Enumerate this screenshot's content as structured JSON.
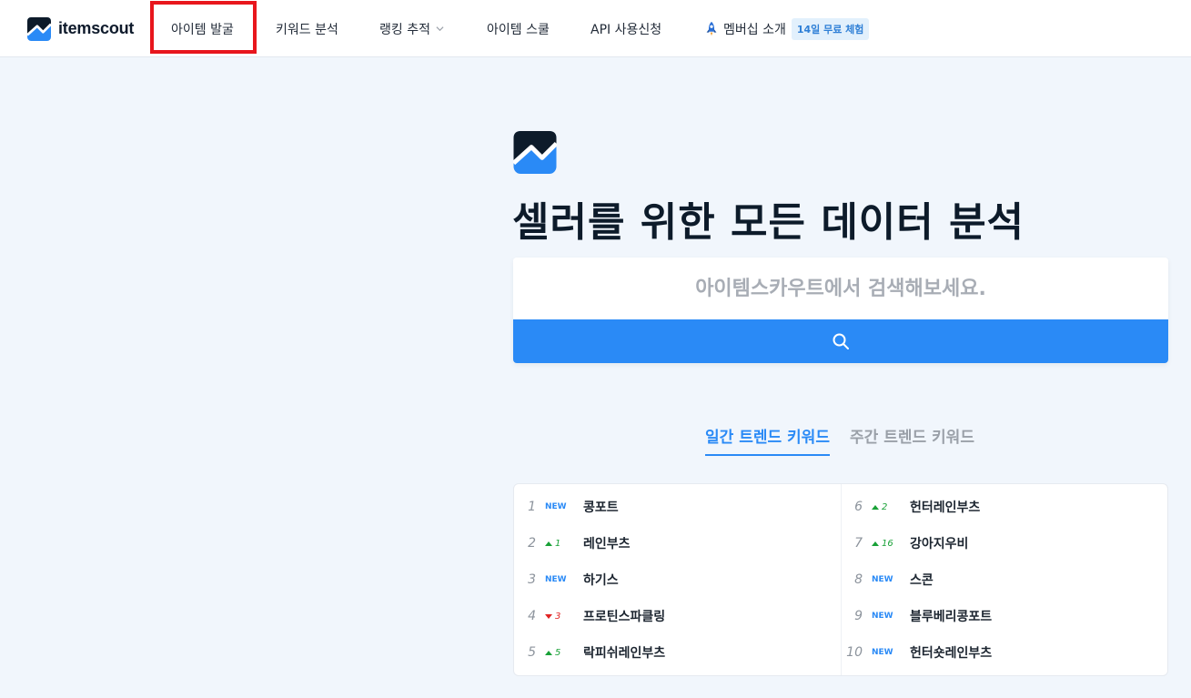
{
  "header": {
    "logo_text": "itemscout",
    "nav": [
      {
        "label": "아이템 발굴"
      },
      {
        "label": "키워드 분석"
      },
      {
        "label": "랭킹 추적"
      },
      {
        "label": "아이템 스쿨"
      },
      {
        "label": "API 사용신청"
      },
      {
        "label": "멤버십 소개"
      }
    ],
    "trial_badge": "14일 무료 체험"
  },
  "hero": {
    "title": "셀러를 위한 모든 데이터 분석",
    "search_placeholder": "아이템스카우트에서 검색해보세요."
  },
  "tabs": [
    {
      "label": "일간 트렌드 키워드",
      "active": true
    },
    {
      "label": "주간 트렌드 키워드",
      "active": false
    }
  ],
  "trends": [
    {
      "rank": "1",
      "change_type": "new",
      "change": "NEW",
      "keyword": "콩포트"
    },
    {
      "rank": "2",
      "change_type": "up",
      "change": "1",
      "keyword": "레인부츠"
    },
    {
      "rank": "3",
      "change_type": "new",
      "change": "NEW",
      "keyword": "하기스"
    },
    {
      "rank": "4",
      "change_type": "down",
      "change": "3",
      "keyword": "프로틴스파클링"
    },
    {
      "rank": "5",
      "change_type": "up",
      "change": "5",
      "keyword": "락피쉬레인부츠"
    },
    {
      "rank": "6",
      "change_type": "up",
      "change": "2",
      "keyword": "헌터레인부츠"
    },
    {
      "rank": "7",
      "change_type": "up",
      "change": "16",
      "keyword": "강아지우비"
    },
    {
      "rank": "8",
      "change_type": "new",
      "change": "NEW",
      "keyword": "스콘"
    },
    {
      "rank": "9",
      "change_type": "new",
      "change": "NEW",
      "keyword": "블루베리콩포트"
    },
    {
      "rank": "10",
      "change_type": "new",
      "change": "NEW",
      "keyword": "헌터숏레인부츠"
    }
  ],
  "colors": {
    "accent": "#2a8af6",
    "highlight_border": "#e8161d",
    "up": "#19a137",
    "down": "#e02424"
  }
}
